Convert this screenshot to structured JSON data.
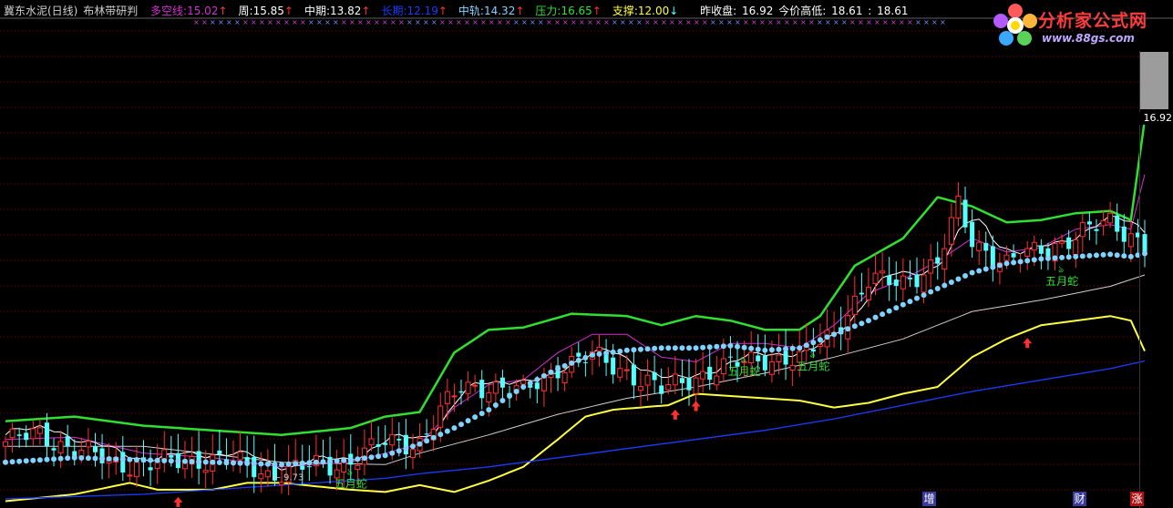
{
  "header": {
    "stock_name": "冀东水泥(日线)",
    "indicator_name": "布林带研判",
    "items": [
      {
        "label": "多空线:",
        "value": "15.02",
        "arrow": "↑",
        "color": "#d030d0"
      },
      {
        "label": "周:",
        "value": "15.85",
        "arrow": "↑",
        "color": "#ffffff"
      },
      {
        "label": "中期:",
        "value": "13.82",
        "arrow": "↑",
        "color": "#ffffff"
      },
      {
        "label": "长期:",
        "value": "12.19",
        "arrow": "↑",
        "color": "#1a3cff"
      },
      {
        "label": "中轨:",
        "value": "14.32",
        "arrow": "↑",
        "color": "#7fd4ff"
      },
      {
        "label": "压力:",
        "value": "16.65",
        "arrow": "↑",
        "color": "#30e030"
      },
      {
        "label": "支撑:",
        "value": "12.00",
        "arrow": "↓",
        "color": "#ffff40"
      }
    ],
    "prev_close_label": "昨收盘:",
    "prev_close_value": "16.92",
    "today_range_label": "今价高低:",
    "today_high": "18.61",
    "today_low": "18.61"
  },
  "logo": {
    "text": "分析家公式网",
    "url": "www.88gs.com"
  },
  "price_tag": "16.92",
  "low_marker": "9.73",
  "signal_text": "五月蛇",
  "event_markers": [
    "增",
    "财",
    "涨"
  ],
  "colors": {
    "bg": "#000000",
    "grid": "#8b0000",
    "up": "#ff3030",
    "down": "#54ffff",
    "upper_band": "#30e030",
    "lower_band": "#ffff40",
    "mid_band_dots": "#7fd4ff",
    "long_line": "#1a3cff",
    "mid_line": "#d0d0d0",
    "short_line": "#ffffff",
    "bullbear": "#d030d0"
  },
  "chart_data": {
    "type": "candlestick",
    "ylim": [
      9.0,
      19.0
    ],
    "n_bars": 166,
    "signals": [
      {
        "bar": 50,
        "text": "五月蛇"
      },
      {
        "bar": 107,
        "text": "五月蛇"
      },
      {
        "bar": 117,
        "text": "五月蛇"
      },
      {
        "bar": 153,
        "text": "五月蛇"
      }
    ],
    "buy_arrows": [
      25,
      97,
      100,
      148
    ],
    "low_marker": {
      "bar": 39,
      "value": 9.73
    },
    "anchors": {
      "close": [
        [
          0,
          10.45
        ],
        [
          5,
          10.6
        ],
        [
          10,
          10.3
        ],
        [
          15,
          10.0
        ],
        [
          20,
          9.95
        ],
        [
          25,
          10.0
        ],
        [
          30,
          10.1
        ],
        [
          35,
          9.9
        ],
        [
          38,
          9.75
        ],
        [
          42,
          9.85
        ],
        [
          48,
          9.95
        ],
        [
          52,
          10.2
        ],
        [
          55,
          10.4
        ],
        [
          60,
          10.45
        ],
        [
          63,
          11.1
        ],
        [
          66,
          11.6
        ],
        [
          70,
          11.7
        ],
        [
          75,
          11.5
        ],
        [
          80,
          12.1
        ],
        [
          85,
          12.3
        ],
        [
          90,
          12.0
        ],
        [
          95,
          11.55
        ],
        [
          100,
          11.9
        ],
        [
          105,
          12.1
        ],
        [
          110,
          12.3
        ],
        [
          115,
          12.2
        ],
        [
          120,
          12.9
        ],
        [
          125,
          13.9
        ],
        [
          130,
          14.0
        ],
        [
          135,
          14.3
        ],
        [
          138,
          15.6
        ],
        [
          140,
          14.9
        ],
        [
          145,
          14.3
        ],
        [
          150,
          14.7
        ],
        [
          155,
          14.9
        ],
        [
          160,
          15.3
        ],
        [
          163,
          15.0
        ],
        [
          165,
          14.7
        ]
      ],
      "upper": [
        [
          0,
          10.9
        ],
        [
          10,
          11.0
        ],
        [
          20,
          10.8
        ],
        [
          30,
          10.7
        ],
        [
          40,
          10.6
        ],
        [
          50,
          10.75
        ],
        [
          55,
          11.0
        ],
        [
          60,
          11.1
        ],
        [
          65,
          12.4
        ],
        [
          70,
          12.9
        ],
        [
          75,
          12.95
        ],
        [
          82,
          13.25
        ],
        [
          90,
          13.2
        ],
        [
          95,
          13.0
        ],
        [
          100,
          13.2
        ],
        [
          105,
          13.1
        ],
        [
          110,
          12.9
        ],
        [
          115,
          12.9
        ],
        [
          118,
          13.2
        ],
        [
          123,
          14.3
        ],
        [
          130,
          14.9
        ],
        [
          135,
          15.8
        ],
        [
          140,
          15.6
        ],
        [
          145,
          15.25
        ],
        [
          150,
          15.3
        ],
        [
          155,
          15.45
        ],
        [
          160,
          15.5
        ],
        [
          163,
          15.3
        ],
        [
          166,
          18.6
        ]
      ],
      "lower": [
        [
          0,
          9.15
        ],
        [
          10,
          9.3
        ],
        [
          18,
          9.55
        ],
        [
          22,
          9.4
        ],
        [
          30,
          9.4
        ],
        [
          35,
          9.55
        ],
        [
          40,
          9.55
        ],
        [
          50,
          9.4
        ],
        [
          55,
          9.35
        ],
        [
          60,
          9.5
        ],
        [
          65,
          9.35
        ],
        [
          70,
          9.6
        ],
        [
          75,
          9.9
        ],
        [
          80,
          10.5
        ],
        [
          84,
          11.0
        ],
        [
          88,
          11.15
        ],
        [
          92,
          11.2
        ],
        [
          96,
          11.25
        ],
        [
          100,
          11.5
        ],
        [
          105,
          11.45
        ],
        [
          110,
          11.4
        ],
        [
          115,
          11.35
        ],
        [
          120,
          11.2
        ],
        [
          125,
          11.3
        ],
        [
          130,
          11.5
        ],
        [
          135,
          11.65
        ],
        [
          140,
          12.3
        ],
        [
          145,
          12.7
        ],
        [
          150,
          13.0
        ],
        [
          155,
          13.1
        ],
        [
          160,
          13.2
        ],
        [
          163,
          13.1
        ],
        [
          166,
          12.1
        ]
      ],
      "mid": [
        [
          0,
          10.0
        ],
        [
          10,
          10.1
        ],
        [
          20,
          10.05
        ],
        [
          30,
          10.0
        ],
        [
          40,
          9.95
        ],
        [
          50,
          10.05
        ],
        [
          55,
          10.15
        ],
        [
          60,
          10.4
        ],
        [
          65,
          10.75
        ],
        [
          70,
          11.15
        ],
        [
          75,
          11.65
        ],
        [
          80,
          12.05
        ],
        [
          85,
          12.35
        ],
        [
          90,
          12.45
        ],
        [
          95,
          12.5
        ],
        [
          100,
          12.5
        ],
        [
          105,
          12.55
        ],
        [
          110,
          12.45
        ],
        [
          115,
          12.5
        ],
        [
          120,
          12.8
        ],
        [
          125,
          13.1
        ],
        [
          130,
          13.45
        ],
        [
          135,
          13.8
        ],
        [
          140,
          14.15
        ],
        [
          145,
          14.35
        ],
        [
          150,
          14.45
        ],
        [
          155,
          14.5
        ],
        [
          160,
          14.55
        ],
        [
          163,
          14.5
        ],
        [
          166,
          14.6
        ]
      ],
      "long": [
        [
          0,
          9.2
        ],
        [
          20,
          9.3
        ],
        [
          40,
          9.5
        ],
        [
          55,
          9.65
        ],
        [
          60,
          9.75
        ],
        [
          70,
          9.9
        ],
        [
          80,
          10.1
        ],
        [
          90,
          10.3
        ],
        [
          100,
          10.5
        ],
        [
          110,
          10.7
        ],
        [
          120,
          10.95
        ],
        [
          130,
          11.25
        ],
        [
          140,
          11.55
        ],
        [
          150,
          11.8
        ],
        [
          160,
          12.05
        ],
        [
          166,
          12.25
        ]
      ],
      "midline": [
        [
          0,
          10.35
        ],
        [
          20,
          10.35
        ],
        [
          40,
          10.0
        ],
        [
          55,
          9.95
        ],
        [
          60,
          10.2
        ],
        [
          70,
          10.6
        ],
        [
          80,
          11.05
        ],
        [
          90,
          11.4
        ],
        [
          100,
          11.65
        ],
        [
          110,
          11.95
        ],
        [
          120,
          12.3
        ],
        [
          130,
          12.7
        ],
        [
          140,
          13.3
        ],
        [
          150,
          13.55
        ],
        [
          160,
          13.85
        ],
        [
          166,
          14.15
        ]
      ],
      "bullbear": [
        [
          0,
          10.5
        ],
        [
          10,
          10.55
        ],
        [
          20,
          10.2
        ],
        [
          30,
          10.1
        ],
        [
          40,
          9.9
        ],
        [
          50,
          10.0
        ],
        [
          60,
          10.4
        ],
        [
          65,
          11.2
        ],
        [
          70,
          11.7
        ],
        [
          75,
          11.8
        ],
        [
          80,
          12.4
        ],
        [
          85,
          12.8
        ],
        [
          90,
          12.8
        ],
        [
          95,
          12.3
        ],
        [
          100,
          12.2
        ],
        [
          105,
          12.6
        ],
        [
          110,
          12.6
        ],
        [
          115,
          12.5
        ],
        [
          120,
          13.0
        ],
        [
          125,
          13.7
        ],
        [
          130,
          14.0
        ],
        [
          135,
          14.4
        ],
        [
          140,
          14.9
        ],
        [
          145,
          14.6
        ],
        [
          150,
          14.7
        ],
        [
          155,
          15.1
        ],
        [
          160,
          15.2
        ],
        [
          163,
          15.1
        ],
        [
          166,
          16.9
        ]
      ]
    }
  }
}
